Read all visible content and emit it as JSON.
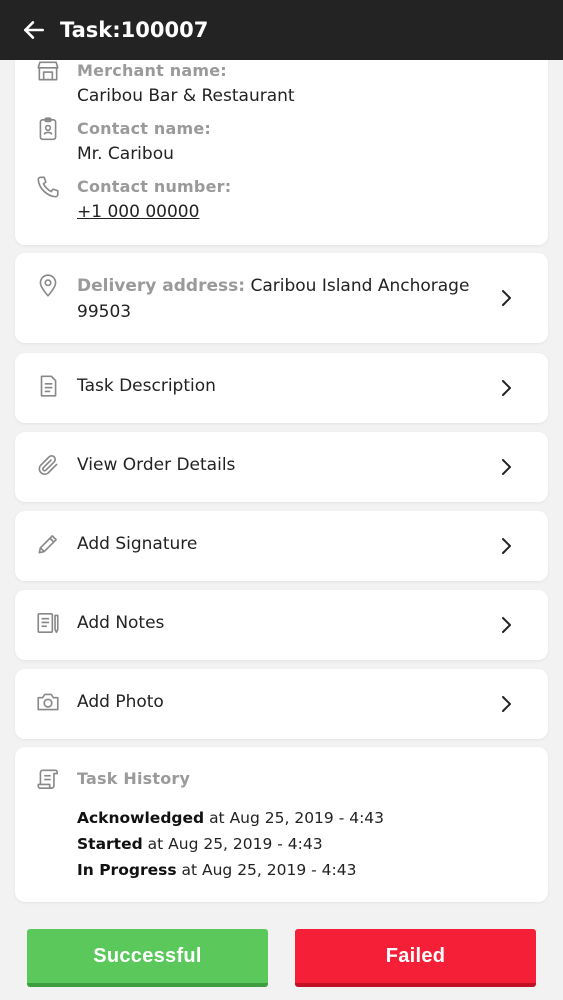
{
  "header": {
    "title": "Task:100007"
  },
  "merchant": {
    "merchant_label": "Merchant name:",
    "merchant_value": "Caribou Bar & Restaurant",
    "contact_label": "Contact name:",
    "contact_value": "Mr. Caribou",
    "phone_label": "Contact number:",
    "phone_value": "+1 000 00000"
  },
  "delivery": {
    "label": "Delivery address:",
    "value": "Caribou Island Anchorage 99503"
  },
  "rows": {
    "task_description": "Task Description",
    "view_order_details": "View Order Details",
    "add_signature": "Add Signature",
    "add_notes": "Add Notes",
    "add_photo": "Add Photo"
  },
  "history": {
    "title": "Task History",
    "entries": [
      {
        "status": "Acknowledged",
        "time": "at Aug 25, 2019 - 4:43"
      },
      {
        "status": "Started",
        "time": "at Aug 25, 2019 - 4:43"
      },
      {
        "status": "In Progress",
        "time": "at Aug 25, 2019 - 4:43"
      }
    ]
  },
  "actions": {
    "successful": "Successful",
    "failed": "Failed"
  },
  "colors": {
    "topbar": "#232323",
    "success": "#5bc85b",
    "failed": "#f52037",
    "muted_label": "#9a9a9a"
  }
}
